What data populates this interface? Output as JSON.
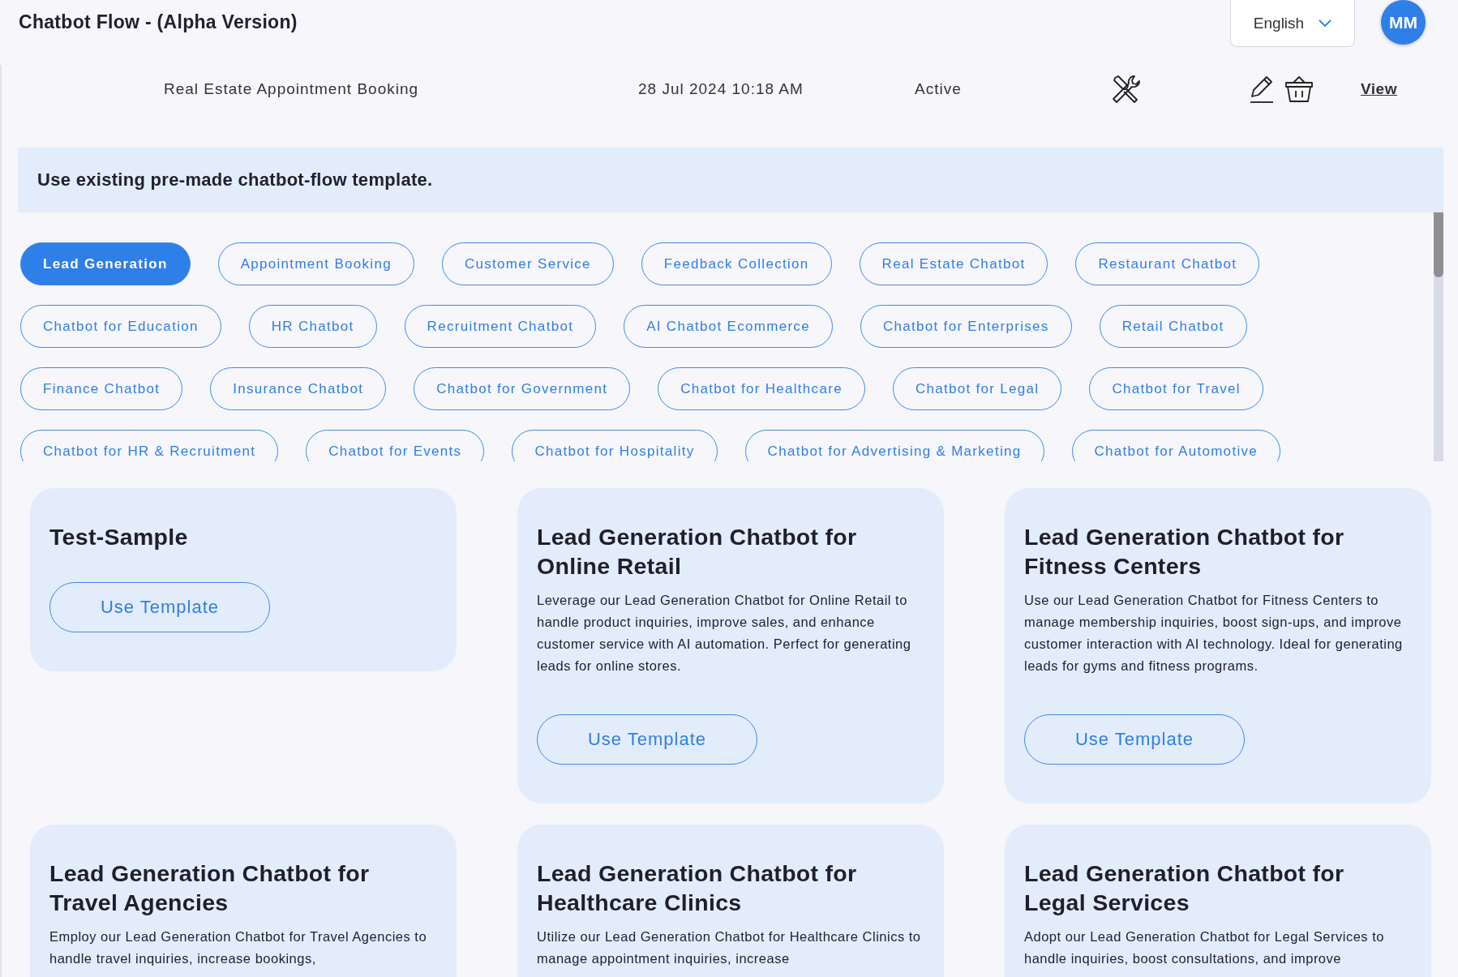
{
  "header": {
    "title": "Chatbot Flow - (Alpha Version)",
    "language": "English",
    "avatar": "MM"
  },
  "flow_row": {
    "name": "Real Estate Appointment Booking",
    "date": "28 Jul 2024 10:18 AM",
    "status": "Active",
    "view_link": "View"
  },
  "banner": "Use existing pre-made chatbot-flow template.",
  "categories": [
    {
      "label": "Lead Generation",
      "selected": true
    },
    {
      "label": "Appointment Booking",
      "selected": false
    },
    {
      "label": "Customer Service",
      "selected": false
    },
    {
      "label": "Feedback Collection",
      "selected": false
    },
    {
      "label": "Real Estate Chatbot",
      "selected": false
    },
    {
      "label": "Restaurant Chatbot",
      "selected": false
    },
    {
      "label": "Chatbot for Education",
      "selected": false
    },
    {
      "label": "HR Chatbot",
      "selected": false
    },
    {
      "label": "Recruitment Chatbot",
      "selected": false
    },
    {
      "label": "AI Chatbot Ecommerce",
      "selected": false
    },
    {
      "label": "Chatbot for Enterprises",
      "selected": false
    },
    {
      "label": "Retail Chatbot",
      "selected": false
    },
    {
      "label": "Finance Chatbot",
      "selected": false
    },
    {
      "label": "Insurance Chatbot",
      "selected": false
    },
    {
      "label": "Chatbot for Government",
      "selected": false
    },
    {
      "label": "Chatbot for Healthcare",
      "selected": false
    },
    {
      "label": "Chatbot for Legal",
      "selected": false
    },
    {
      "label": "Chatbot for Travel",
      "selected": false
    },
    {
      "label": "Chatbot for HR & Recruitment",
      "selected": false
    },
    {
      "label": "Chatbot for Events",
      "selected": false
    },
    {
      "label": "Chatbot for Hospitality",
      "selected": false
    },
    {
      "label": "Chatbot for Advertising & Marketing",
      "selected": false
    },
    {
      "label": "Chatbot for Automotive",
      "selected": false
    }
  ],
  "templates": [
    {
      "title": "Test-Sample",
      "button": "Use Template"
    },
    {
      "title": "Lead Generation Chatbot for Online Retail",
      "description": "Leverage our Lead Generation Chatbot for Online Retail to handle product inquiries, improve sales, and enhance customer service with AI automation. Perfect for generating leads for online stores.",
      "button": "Use Template"
    },
    {
      "title": "Lead Generation Chatbot for Fitness Centers",
      "description": "Use our Lead Generation Chatbot for Fitness Centers to manage membership inquiries, boost sign-ups, and improve customer interaction with AI technology. Ideal for generating leads for gyms and fitness programs.",
      "button": "Use Template"
    },
    {
      "title": "Lead Generation Chatbot for Travel Agencies",
      "description": "Employ our Lead Generation Chatbot for Travel Agencies to handle travel inquiries, increase bookings,"
    },
    {
      "title": "Lead Generation Chatbot for Healthcare Clinics",
      "description": "Utilize our Lead Generation Chatbot for Healthcare Clinics to manage appointment inquiries, increase"
    },
    {
      "title": "Lead Generation Chatbot for Legal Services",
      "description": "Adopt our Lead Generation Chatbot for Legal Services to handle inquiries, boost consultations, and improve"
    }
  ]
}
